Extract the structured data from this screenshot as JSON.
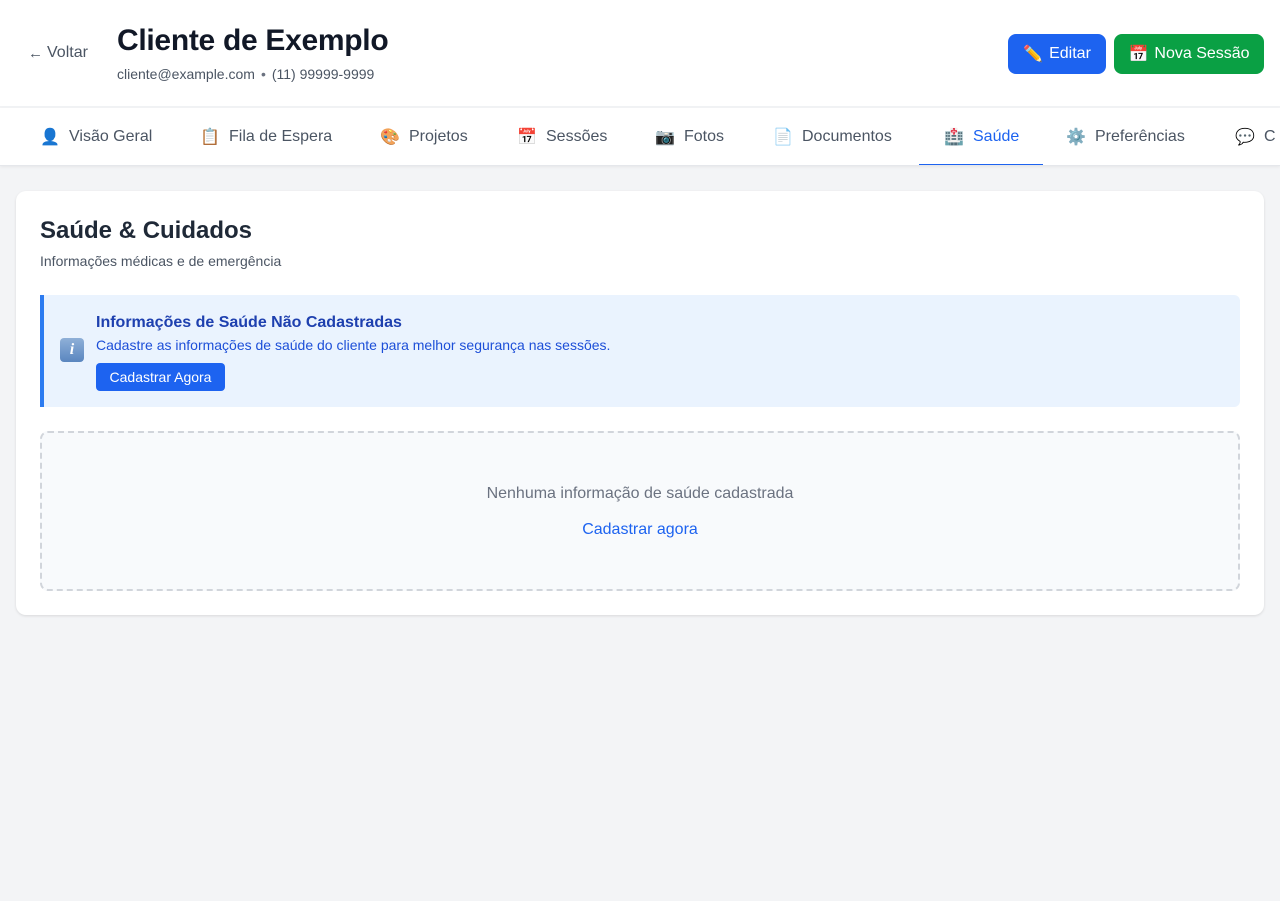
{
  "header": {
    "back_label": "Voltar",
    "back_icon": "arrow-left-icon",
    "client_name": "Cliente de Exemplo",
    "client_email": "cliente@example.com",
    "separator": "•",
    "client_phone": "(11) 99999-9999",
    "edit_icon": "✏️",
    "edit_label": "Editar",
    "new_session_icon": "📅",
    "new_session_label": "Nova Sessão",
    "colors": {
      "edit_button": "#1d63f0",
      "new_session_button": "#0aa044"
    }
  },
  "tabs": [
    {
      "icon": "👤",
      "label": "Visão Geral",
      "active": false
    },
    {
      "icon": "📋",
      "label": "Fila de Espera",
      "active": false
    },
    {
      "icon": "🎨",
      "label": "Projetos",
      "active": false
    },
    {
      "icon": "📅",
      "label": "Sessões",
      "active": false
    },
    {
      "icon": "📷",
      "label": "Fotos",
      "active": false
    },
    {
      "icon": "📄",
      "label": "Documentos",
      "active": false
    },
    {
      "icon": "🏥",
      "label": "Saúde",
      "active": true
    },
    {
      "icon": "⚙️",
      "label": "Preferências",
      "active": false
    },
    {
      "icon": "💬",
      "label": "C",
      "active": false
    }
  ],
  "health": {
    "title": "Saúde & Cuidados",
    "subtitle": "Informações médicas e de emergência",
    "alert": {
      "icon": "info-icon",
      "icon_glyph": "i",
      "title": "Informações de Saúde Não Cadastradas",
      "text": "Cadastre as informações de saúde do cliente para melhor segurança nas sessões.",
      "button_label": "Cadastrar Agora"
    },
    "empty_state": {
      "text": "Nenhuma informação de saúde cadastrada",
      "link_label": "Cadastrar agora"
    }
  },
  "colors": {
    "accent": "#1d63f0",
    "page_background": "#f3f4f6"
  }
}
